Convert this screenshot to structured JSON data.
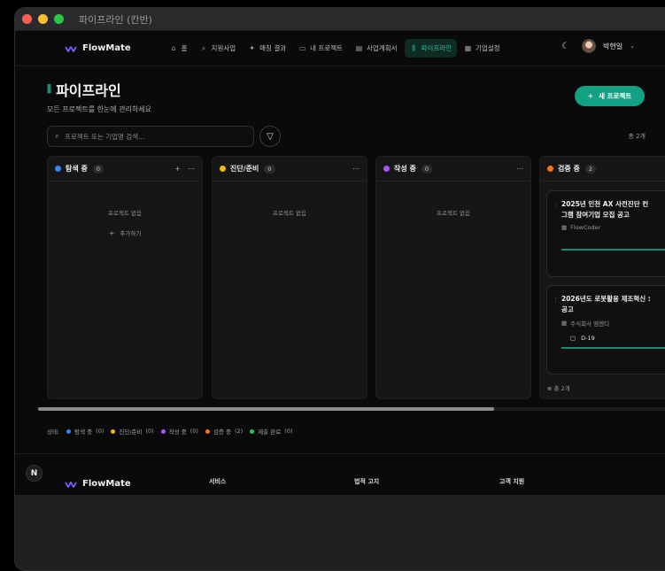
{
  "window": {
    "title": "파이프라인 (칸반)"
  },
  "nav": {
    "brand": "FlowMate",
    "items": [
      {
        "label": "홈",
        "icon": "home-icon",
        "glyph": "⌂"
      },
      {
        "label": "지원사업",
        "icon": "search-icon",
        "glyph": "⌕"
      },
      {
        "label": "매칭 결과",
        "icon": "sparkle-icon",
        "glyph": "✦"
      },
      {
        "label": "내 프로젝트",
        "icon": "folder-icon",
        "glyph": "▭"
      },
      {
        "label": "사업계획서",
        "icon": "document-icon",
        "glyph": "▤"
      },
      {
        "label": "파이프라인",
        "icon": "kanban-icon",
        "glyph": "⫼",
        "active": true
      },
      {
        "label": "기업설정",
        "icon": "building-icon",
        "glyph": "▦"
      }
    ],
    "user": "박현일"
  },
  "header": {
    "title": "파이프라인",
    "subtitle": "모든 프로젝트를 한눈에 관리하세요",
    "new_button": "새 프로젝트"
  },
  "search": {
    "placeholder": "프로젝트 또는 기업명 검색..."
  },
  "total": "총 2개",
  "columns": [
    {
      "title": "탐색 중",
      "count": "0",
      "color": "#3b82f6",
      "empty": "프로젝트 없음",
      "add": "추가하기"
    },
    {
      "title": "진단/준비",
      "count": "0",
      "color": "#f5b50a",
      "empty": "프로젝트 없음"
    },
    {
      "title": "작성 중",
      "count": "0",
      "color": "#a855f7",
      "empty": "프로젝트 없음"
    },
    {
      "title": "검증 중",
      "count": "2",
      "color": "#f97316",
      "footer": "총 2개"
    }
  ],
  "cards": [
    {
      "title": "2025년 인천 AX 사전진단 컨\n그램 참여기업 모집 공고",
      "org": "FlowCoder"
    },
    {
      "title": "2026년도 로봇활용 제조혁신 :\n공고",
      "org": "주식회사 엠젠디",
      "dday": "D-19"
    }
  ],
  "legend": {
    "label": "상태:",
    "items": [
      {
        "name": "탐색 중",
        "count": "(0)",
        "color": "#3b82f6"
      },
      {
        "name": "진단/준비",
        "count": "(0)",
        "color": "#f5b50a"
      },
      {
        "name": "작성 중",
        "count": "(0)",
        "color": "#a855f7"
      },
      {
        "name": "검증 중",
        "count": "(2)",
        "color": "#f97316"
      },
      {
        "name": "제출 완료",
        "count": "(0)",
        "color": "#22c55e"
      }
    ]
  },
  "footer": {
    "badge": "N",
    "brand": "FlowMate",
    "cols": [
      "서비스",
      "법적 고지",
      "고객 지원"
    ]
  }
}
